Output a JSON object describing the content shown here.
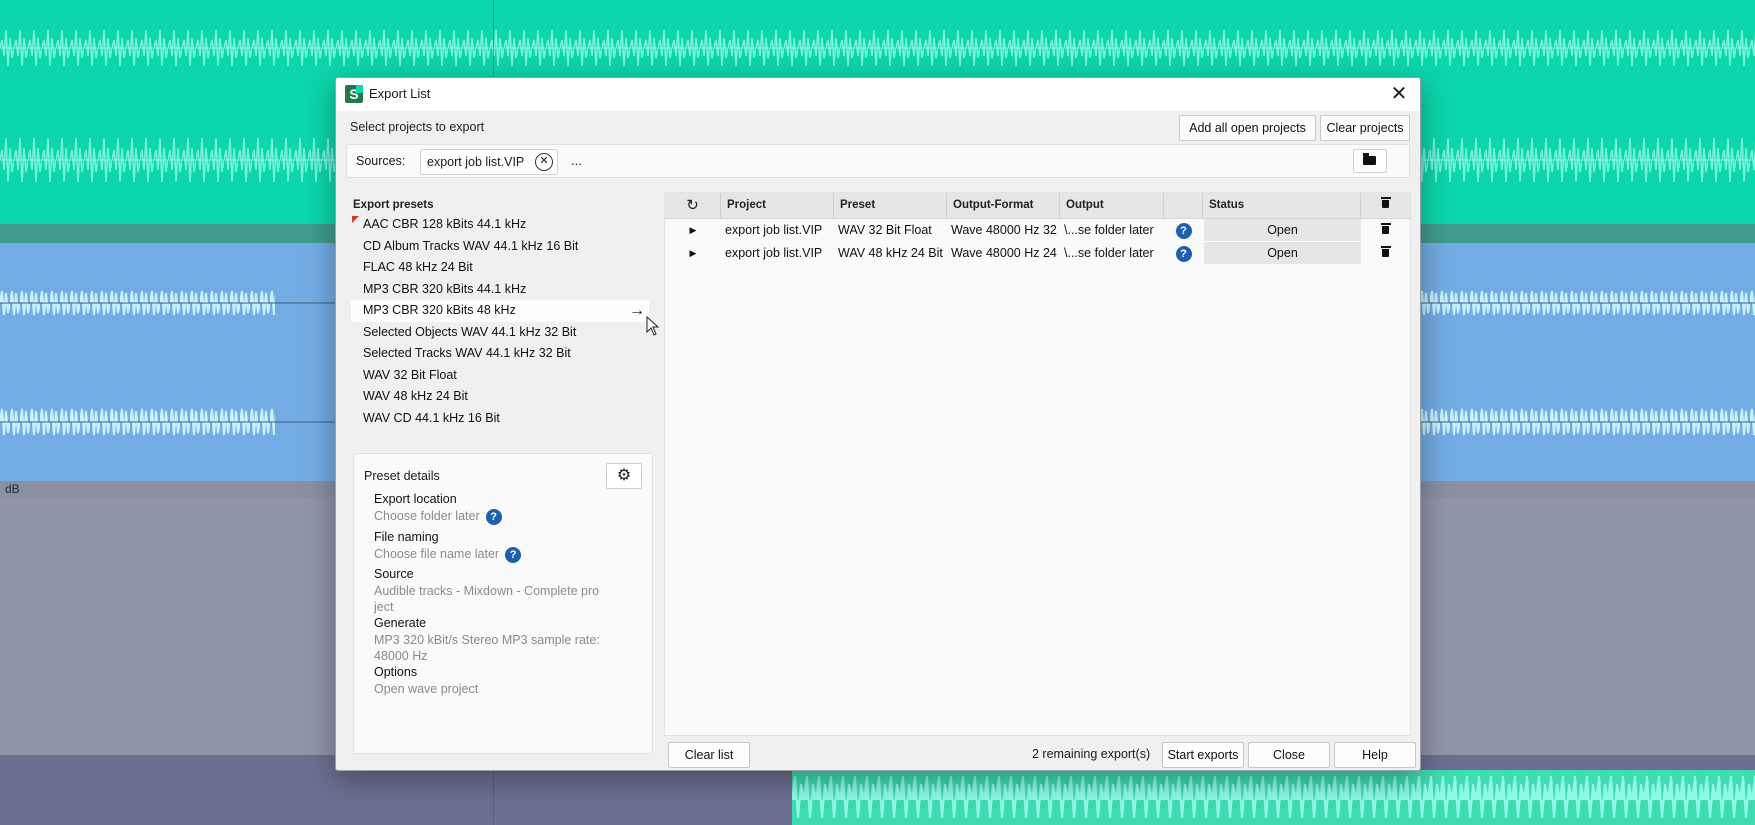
{
  "background": {
    "db_label": "dB"
  },
  "dialog": {
    "title": "Export List",
    "logo_letter": "S",
    "close_glyph": "✕",
    "select_label": "Select projects to export",
    "add_all_label": "Add all open projects",
    "clear_projects_label": "Clear projects",
    "sources_label": "Sources:",
    "source_chip": "export job list.VIP",
    "more_label": "...",
    "presets_title": "Export presets",
    "presets": [
      "AAC CBR 128 kBits 44.1 kHz",
      "CD Album Tracks WAV 44.1 kHz 16 Bit",
      "FLAC 48 kHz 24 Bit",
      "MP3 CBR 320 kBits 44.1 kHz",
      "MP3 CBR 320 kBits 48 kHz",
      "Selected Objects WAV 44.1 kHz 32 Bit",
      "Selected Tracks WAV 44.1 kHz 32 Bit",
      "WAV 32 Bit Float",
      "WAV 48 kHz 24 Bit",
      "WAV CD 44.1 kHz 16 Bit"
    ],
    "preset_arrow": "→",
    "details": {
      "title": "Preset details",
      "gear_glyph": "⚙",
      "export_location_key": "Export location",
      "export_location_val": "Choose folder later",
      "file_naming_key": "File naming",
      "file_naming_val": "Choose file name later",
      "source_key": "Source",
      "source_val_1": "Audible tracks - Mixdown - Complete pro",
      "source_val_2": "ject",
      "generate_key": "Generate",
      "generate_val_1": "MP3 320 kBit/s Stereo  MP3 sample rate:",
      "generate_val_2": "48000 Hz",
      "options_key": "Options",
      "options_val": "Open wave project",
      "help_glyph": "?"
    },
    "table": {
      "refresh_glyph": "↻",
      "headers": {
        "project": "Project",
        "preset": "Preset",
        "format": "Output-Format",
        "output": "Output",
        "status": "Status"
      },
      "play_glyph": "▶",
      "rows": [
        {
          "project": "export job list.VIP",
          "preset": "WAV 32 Bit Float",
          "format": "Wave 48000 Hz  32",
          "output": "\\...se folder later",
          "status": "Open"
        },
        {
          "project": "export job list.VIP",
          "preset": "WAV 48 kHz 24 Bit",
          "format": "Wave 48000 Hz  24",
          "output": "\\...se folder later",
          "status": "Open"
        }
      ]
    },
    "footer": {
      "clear_list_label": "Clear list",
      "remaining_label": "2 remaining export(s)",
      "start_label": "Start exports",
      "close_label": "Close",
      "help_label": "Help"
    }
  }
}
